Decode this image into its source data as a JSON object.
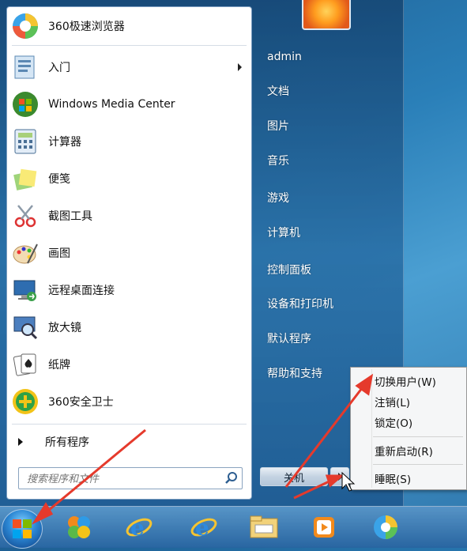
{
  "pinned_apps": [
    {
      "label": "360极速浏览器",
      "icon": "browser-360-icon"
    },
    {
      "label": "入门",
      "icon": "getting-started-icon",
      "has_submenu": true
    },
    {
      "label": "Windows Media Center",
      "icon": "media-center-icon"
    },
    {
      "label": "计算器",
      "icon": "calculator-icon"
    },
    {
      "label": "便笺",
      "icon": "sticky-notes-icon"
    },
    {
      "label": "截图工具",
      "icon": "snipping-tool-icon"
    },
    {
      "label": "画图",
      "icon": "paint-icon"
    },
    {
      "label": "远程桌面连接",
      "icon": "remote-desktop-icon"
    },
    {
      "label": "放大镜",
      "icon": "magnifier-icon"
    },
    {
      "label": "纸牌",
      "icon": "solitaire-icon"
    },
    {
      "label": "360安全卫士",
      "icon": "security-360-icon"
    }
  ],
  "all_programs": "所有程序",
  "search": {
    "placeholder": "搜索程序和文件"
  },
  "right_column": [
    "admin",
    "文档",
    "图片",
    "音乐",
    "游戏",
    "计算机",
    "控制面板",
    "设备和打印机",
    "默认程序",
    "帮助和支持"
  ],
  "shutdown": {
    "label": "关机"
  },
  "context_menu": [
    "切换用户(W)",
    "注销(L)",
    "锁定(O)",
    "重新启动(R)",
    "睡眠(S)"
  ],
  "taskbar": [
    "start-orb-icon",
    "pinwheel-app-icon",
    "ie-icon",
    "ie-icon",
    "file-explorer-icon",
    "media-player-icon",
    "browser-360-icon"
  ],
  "colors": {
    "accent": "#2a7fb8",
    "annotation": "#e53a2c"
  }
}
